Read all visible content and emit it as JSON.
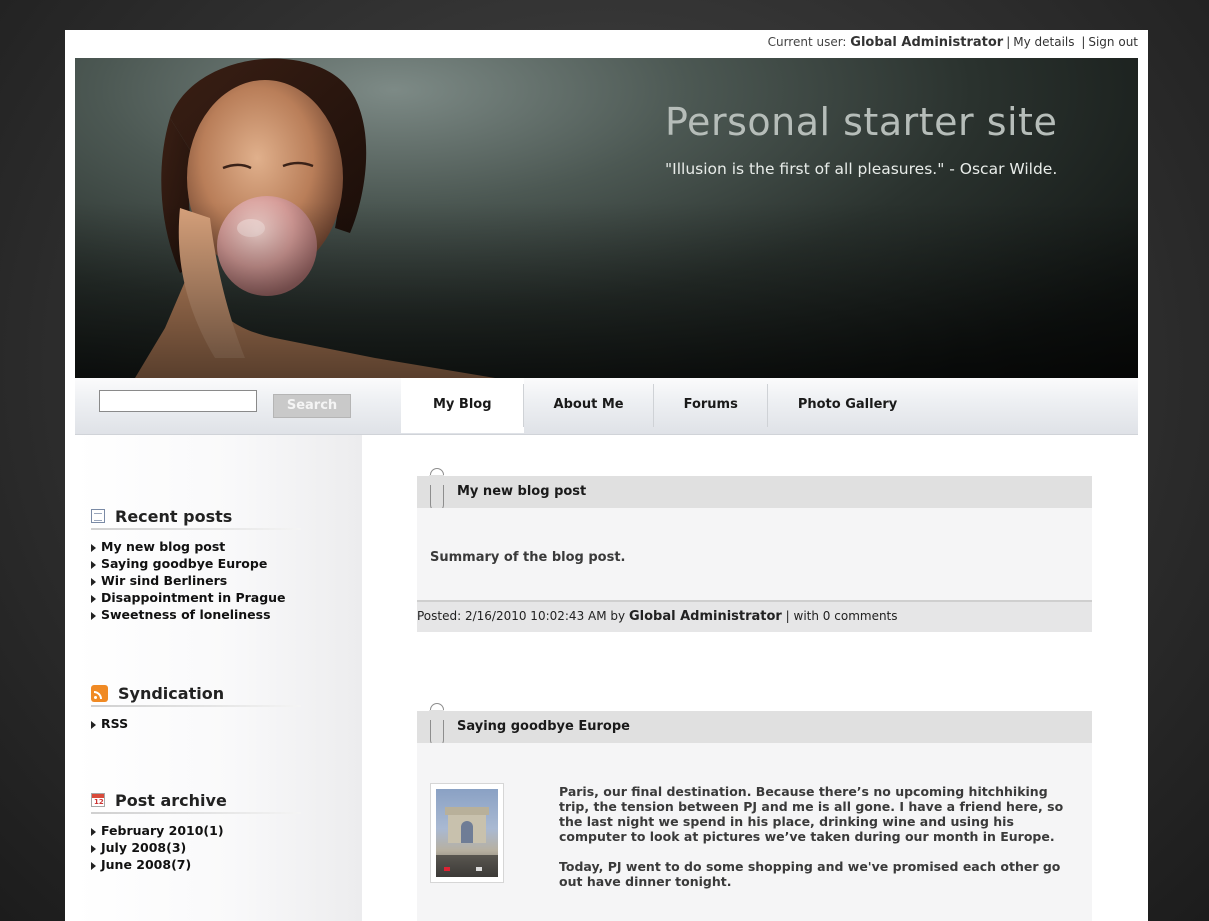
{
  "userbar": {
    "current_user_label": "Current user:",
    "user_name": "Global Administrator",
    "my_details": "My details",
    "sign_out": "Sign out"
  },
  "banner": {
    "site_title": "Personal starter site",
    "quote": "\"Illusion is the first of all pleasures.\" - Oscar Wilde."
  },
  "search": {
    "value": "",
    "button_label": "Search"
  },
  "nav": {
    "tabs": [
      {
        "label": "My Blog",
        "active": true
      },
      {
        "label": "About Me",
        "active": false
      },
      {
        "label": "Forums",
        "active": false
      },
      {
        "label": "Photo Gallery",
        "active": false
      }
    ]
  },
  "sidebar": {
    "recent_posts": {
      "title": "Recent posts",
      "icon": "document-icon",
      "items": [
        "My new blog post",
        "Saying goodbye Europe",
        "Wir sind Berliners",
        "Disappointment in Prague",
        "Sweetness of loneliness"
      ]
    },
    "syndication": {
      "title": "Syndication",
      "icon": "rss-icon",
      "items": [
        "RSS"
      ]
    },
    "archive": {
      "title": "Post archive",
      "icon": "calendar-icon",
      "items": [
        "February 2010(1)",
        "July 2008(3)",
        "June 2008(7)"
      ]
    }
  },
  "posts": [
    {
      "title": "My new blog post",
      "summary": "Summary of the blog post.",
      "posted_prefix": "Posted: 2/16/2010 10:02:43 AM by",
      "author": "Global Administrator",
      "comments": "| with 0 comments"
    },
    {
      "title": "Saying goodbye Europe",
      "paragraph1": "Paris, our final destination. Because there’s no upcoming hitchhiking trip, the tension between PJ and me is all gone. I have a friend here, so the last night we spend in his place, drinking wine and using his computer to look at pictures we’ve taken during our month in Europe.",
      "paragraph2": "Today, PJ went to do some shopping and we've promised each other go out have dinner tonight."
    }
  ],
  "colors": {
    "nav_active": "#ffffff",
    "post_header": "#e0e0e0",
    "rss_orange": "#f08a24"
  }
}
